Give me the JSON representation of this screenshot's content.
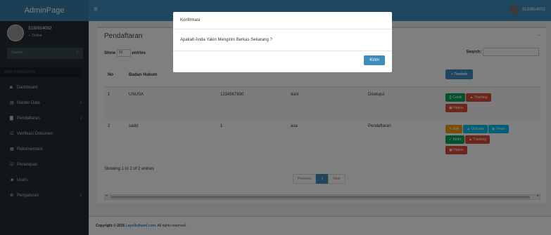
{
  "header": {
    "logo": "AdminPage",
    "toggle_icon": "≡",
    "user": "3130914002"
  },
  "sidebar": {
    "user": {
      "name": "3130914002",
      "status": "Online"
    },
    "search_placeholder": "Search...",
    "menu_header": "MAIN NAVIGATION",
    "items": [
      {
        "label": "Dashboard",
        "icon": "dashboard-icon",
        "glyph": "◙",
        "has_chevron": false
      },
      {
        "label": "Master Data",
        "icon": "database-icon",
        "glyph": "▤",
        "has_chevron": true
      },
      {
        "label": "Pendaftaran",
        "icon": "file-icon",
        "glyph": "▇",
        "has_chevron": true
      },
      {
        "label": "Verifikasi Dokumen",
        "icon": "check-icon",
        "glyph": "☑",
        "has_chevron": false
      },
      {
        "label": "Rekomendasi",
        "icon": "calendar-icon",
        "glyph": "▦",
        "has_chevron": false
      },
      {
        "label": "Penetapan",
        "icon": "check-square-icon",
        "glyph": "☑",
        "has_chevron": false
      },
      {
        "label": "Users",
        "icon": "users-icon",
        "glyph": "☻",
        "has_chevron": false
      },
      {
        "label": "Pengaturan",
        "icon": "gears-icon",
        "glyph": "⚙",
        "has_chevron": true
      }
    ]
  },
  "content": {
    "title": "Pendaftaran",
    "show_label": "Show",
    "entries_value": "10",
    "entries_label": "entries",
    "search_label": "Search:",
    "add_button": "+ Tambah",
    "columns": [
      "No",
      "Badan Hukum",
      "",
      "",
      "",
      ""
    ],
    "rows": [
      {
        "no": "1",
        "badan_hukum": "UNUSA",
        "col3": "1234567890",
        "col4": "dani",
        "status": "Disetujui",
        "actions": [
          {
            "label": "⎙ Cetak",
            "type": "success"
          },
          {
            "label": "▲ Tracking",
            "type": "danger"
          },
          {
            "label": "▣ Hapus",
            "type": "danger"
          }
        ]
      },
      {
        "no": "2",
        "badan_hukum": "sadd",
        "col3": "1",
        "col4": "asa",
        "status": "Pendaftaran",
        "actions": [
          {
            "label": "✎ Edit",
            "type": "warning"
          },
          {
            "label": "▲ Uploads",
            "type": "info"
          },
          {
            "label": "◉ Views",
            "type": "info"
          },
          {
            "label": "✓ Kirim",
            "type": "success"
          },
          {
            "label": "▲ Tracking",
            "type": "danger"
          },
          {
            "label": "▣ Hapus",
            "type": "danger"
          }
        ]
      }
    ],
    "info": "Showing 1 to 2 of 2 entries",
    "pagination": {
      "previous": "Previous",
      "current": "1",
      "next": "Next"
    }
  },
  "footer": {
    "prefix": "Copyright © 2016",
    "link": "Lapolkdhaml.com.",
    "suffix": "All rights reserved."
  },
  "modal": {
    "title": "Konfirmasi",
    "body": "Apakah Anda Yakin Mengirim Berkas Sekarang ?",
    "button": "Kirim"
  }
}
